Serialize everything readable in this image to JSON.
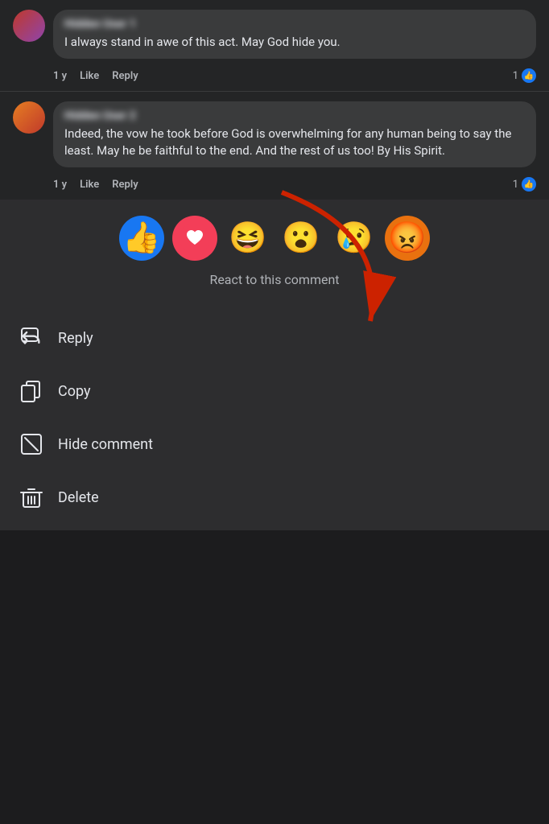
{
  "comments": [
    {
      "id": "comment-1",
      "name": "Hidden User 1",
      "text": "I always stand in awe of this act. May God hide you.",
      "time": "1 y",
      "like_label": "Like",
      "reply_label": "Reply",
      "like_count": "1"
    },
    {
      "id": "comment-2",
      "name": "Hidden User 2",
      "text": "Indeed, the vow he took before God is overwhelming for any human being to say the least. May he be faithful to the end. And the rest of us too! By His Spirit.",
      "time": "1 y",
      "like_label": "Like",
      "reply_label": "Reply",
      "like_count": "1"
    }
  ],
  "reactions": {
    "label": "React to this comment",
    "emojis": [
      {
        "name": "like",
        "emoji": "👍",
        "type": "like"
      },
      {
        "name": "love",
        "emoji": "❤️",
        "type": "love"
      },
      {
        "name": "haha",
        "emoji": "😆",
        "type": "haha"
      },
      {
        "name": "wow",
        "emoji": "😮",
        "type": "wow"
      },
      {
        "name": "sad",
        "emoji": "😢",
        "type": "sad"
      },
      {
        "name": "angry",
        "emoji": "😡",
        "type": "angry"
      }
    ]
  },
  "menu": {
    "items": [
      {
        "id": "reply",
        "label": "Reply",
        "icon": "reply"
      },
      {
        "id": "copy",
        "label": "Copy",
        "icon": "copy"
      },
      {
        "id": "hide-comment",
        "label": "Hide comment",
        "icon": "hide"
      },
      {
        "id": "delete",
        "label": "Delete",
        "icon": "trash"
      }
    ]
  }
}
